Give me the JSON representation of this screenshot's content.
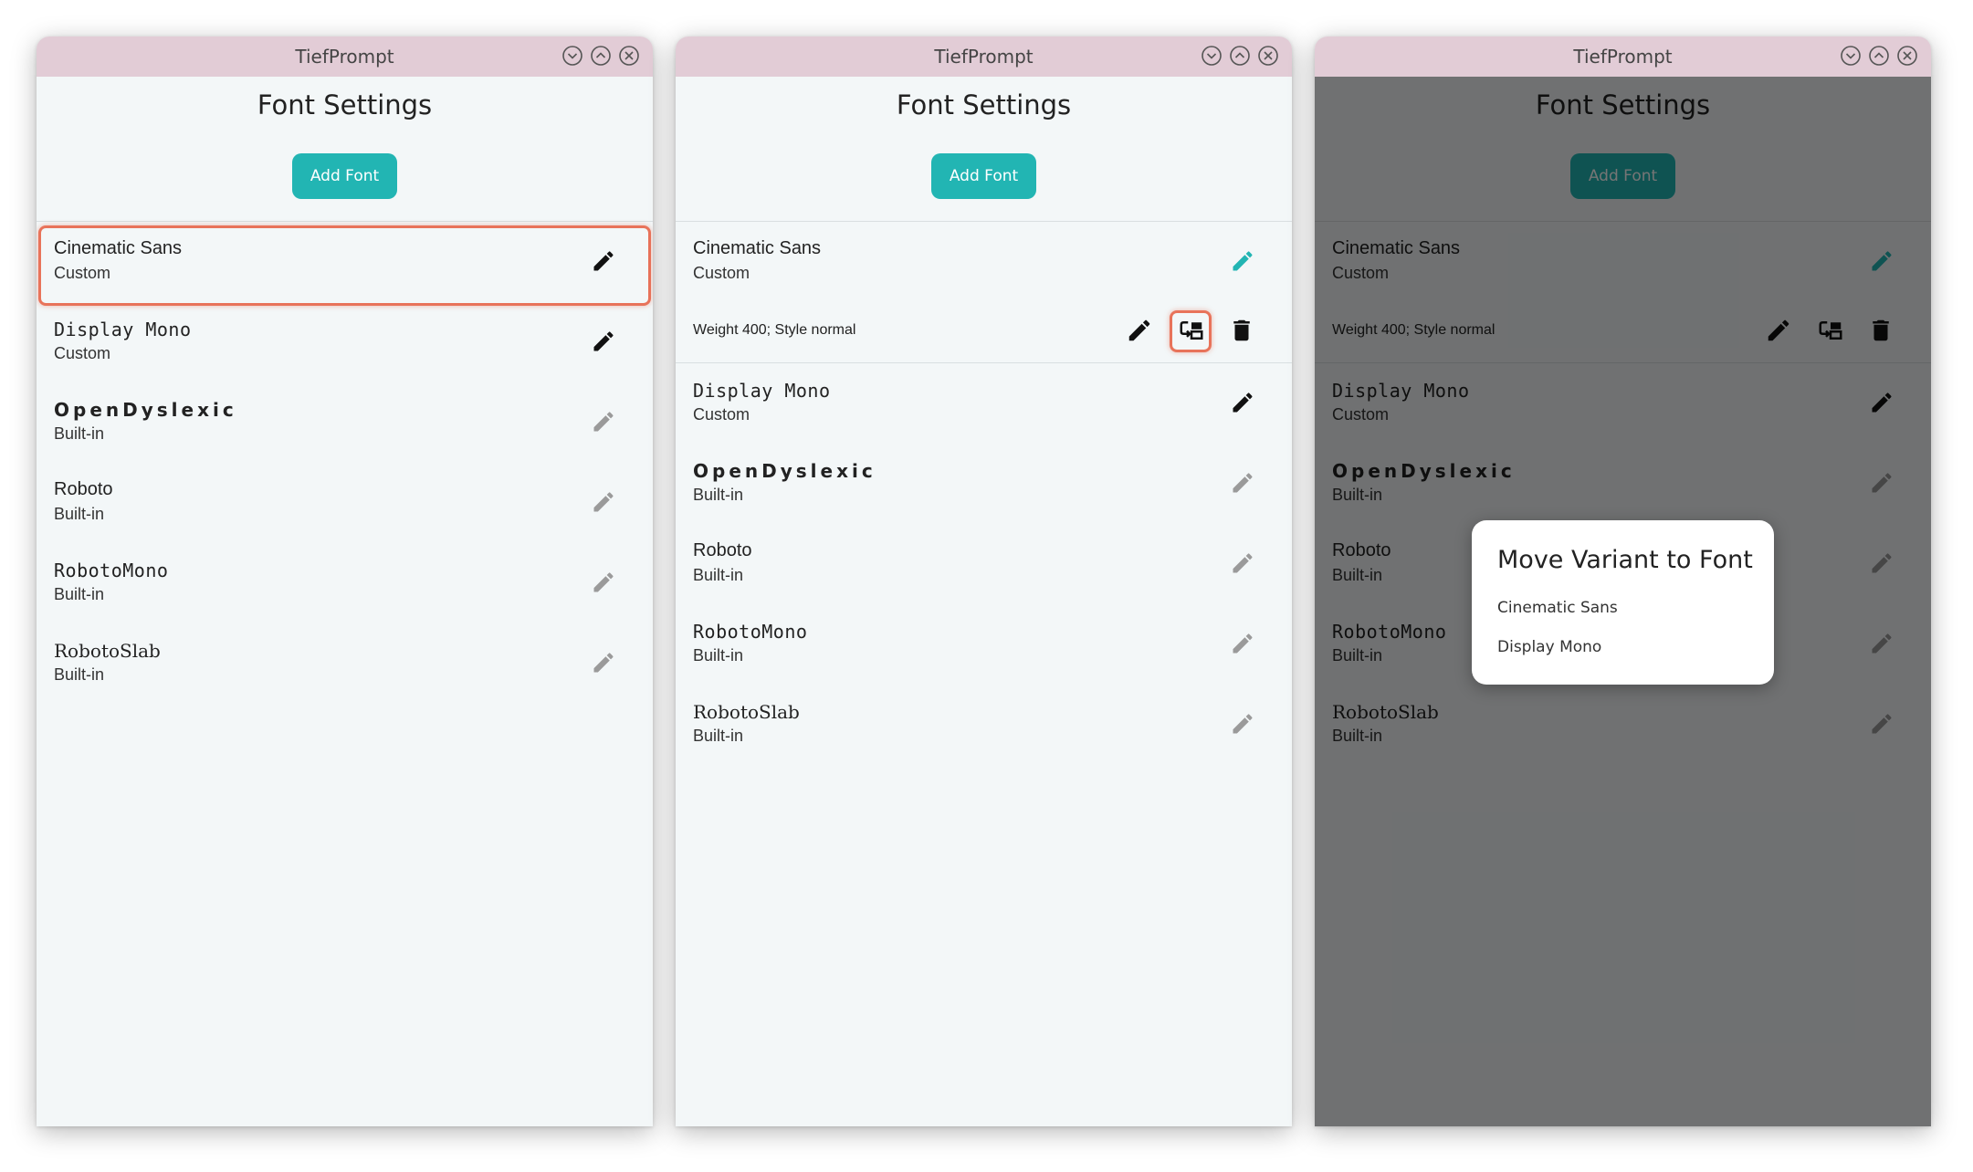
{
  "app_title": "TiefPrompt",
  "page_heading": "Font Settings",
  "add_font_label": "Add Font",
  "fonts": [
    {
      "name": "Cinematic Sans",
      "kind": "Custom"
    },
    {
      "name": "Display Mono",
      "kind": "Custom"
    },
    {
      "name": "OpenDyslexic",
      "kind": "Built-in"
    },
    {
      "name": "Roboto",
      "kind": "Built-in"
    },
    {
      "name": "RobotoMono",
      "kind": "Built-in"
    },
    {
      "name": "RobotoSlab",
      "kind": "Built-in"
    }
  ],
  "variant": {
    "label": "Weight 400; Style normal"
  },
  "dialog": {
    "title": "Move Variant to Font",
    "options": [
      "Cinematic Sans",
      "Display Mono"
    ]
  },
  "colors": {
    "accent": "#22b5b3",
    "titlebar": "#e2ccd6",
    "background": "#f3f7f8",
    "highlight": "#e8735a",
    "icon_active": "#111111",
    "icon_disabled": "#9a9a9a"
  },
  "icons": {
    "window_controls": [
      "minimize-icon",
      "maximize-icon",
      "close-icon"
    ],
    "row_action": "pencil-icon",
    "variant_actions": [
      "pencil-icon",
      "move-variant-icon",
      "trash-icon"
    ]
  }
}
